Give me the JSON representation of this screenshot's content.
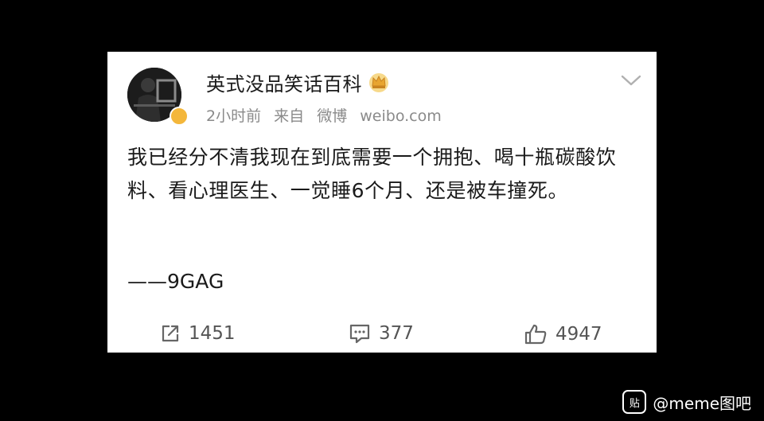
{
  "post": {
    "username": "英式没品笑话百科",
    "time": "2小时前",
    "source_prefix": "来自",
    "source_app": "微博",
    "source_domain": "weibo.com",
    "text": "我已经分不清我现在到底需要一个拥抱、喝十瓶碳酸饮料、看心理医生、一觉睡6个月、还是被车撞死。",
    "signature": "——9GAG"
  },
  "actions": {
    "repost_count": "1451",
    "comment_count": "377",
    "like_count": "4947"
  },
  "watermark": {
    "icon_text": "贴",
    "label": "@meme图吧"
  },
  "colors": {
    "background": "#000000",
    "card": "#ffffff",
    "text": "#1a1a1a",
    "meta": "#8a8a8a",
    "badge": "#f4b73b"
  }
}
